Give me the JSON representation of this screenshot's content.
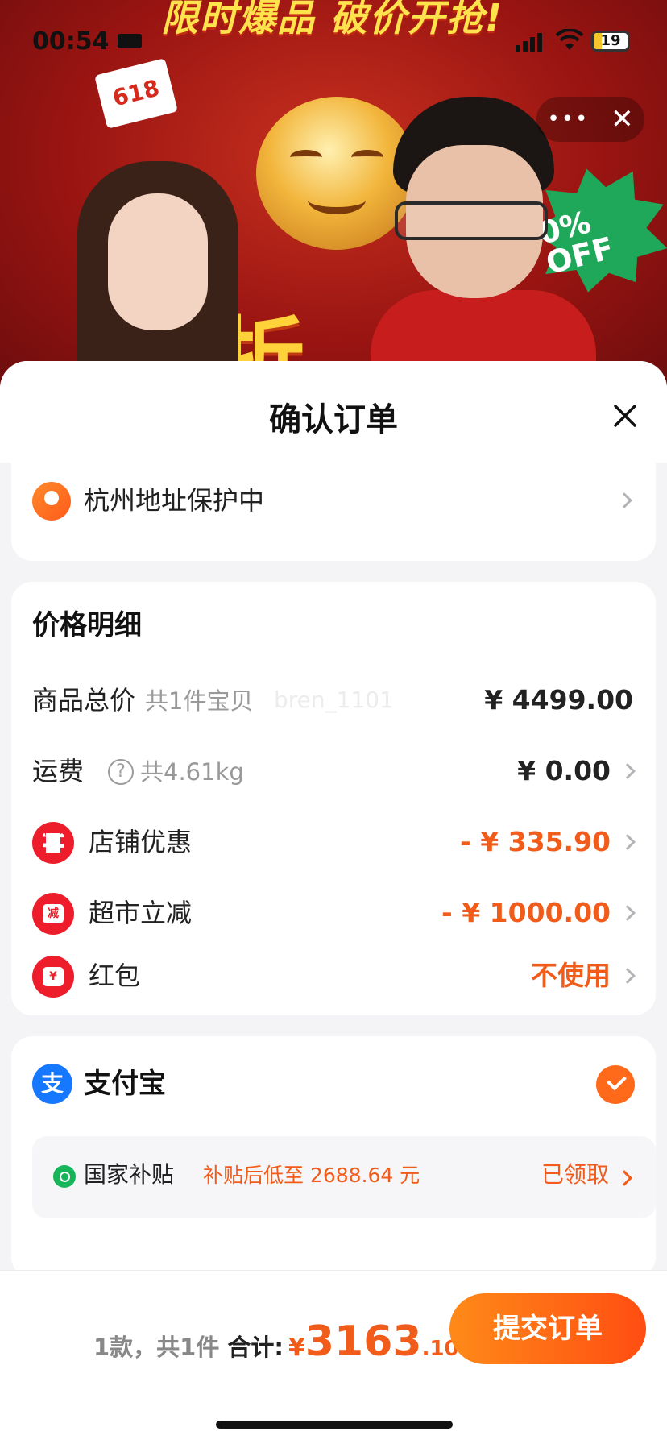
{
  "stream": {
    "banner_text": "限时爆品 破价开抢!",
    "tag_618": "618",
    "off_badge": "0% OFF",
    "big_char": "折"
  },
  "status_bar": {
    "time": "00:54",
    "battery": "19"
  },
  "sheet": {
    "title": "确认订单"
  },
  "address": {
    "text": "杭州地址保护中"
  },
  "price_detail": {
    "title": "价格明细",
    "watermark": "bren_1101",
    "rows": [
      {
        "label": "商品总价",
        "sub": "共1件宝贝",
        "value": "¥ 4499.00"
      },
      {
        "label": "运费",
        "sub": "共4.61kg",
        "value": "¥ 0.00"
      },
      {
        "label": "店铺优惠",
        "value": "- ¥ 335.90",
        "icon": "ticket-icon"
      },
      {
        "label": "超市立减",
        "value": "- ¥ 1000.00",
        "icon_text": "减",
        "icon": "discount-icon"
      },
      {
        "label": "红包",
        "value": "不使用",
        "icon_text": "¥",
        "icon": "red-packet-icon"
      }
    ]
  },
  "payment": {
    "method_icon_text": "支",
    "method": "支付宝",
    "subsidy_name": "国家补贴",
    "subsidy_desc": "补贴后低至 2688.64 元",
    "subsidy_status": "已领取"
  },
  "footer": {
    "count_text": "1款，共1件",
    "total_label": "合计:",
    "currency": "¥",
    "total_int": "3163",
    "total_dec": ".10",
    "submit_label": "提交订单"
  },
  "colors": {
    "accent": "#f25c1a",
    "submit_gradient_start": "#ff8a18",
    "submit_gradient_end": "#ff4d12",
    "alipay_blue": "#1677ff",
    "subsidy_green": "#17b55a"
  }
}
